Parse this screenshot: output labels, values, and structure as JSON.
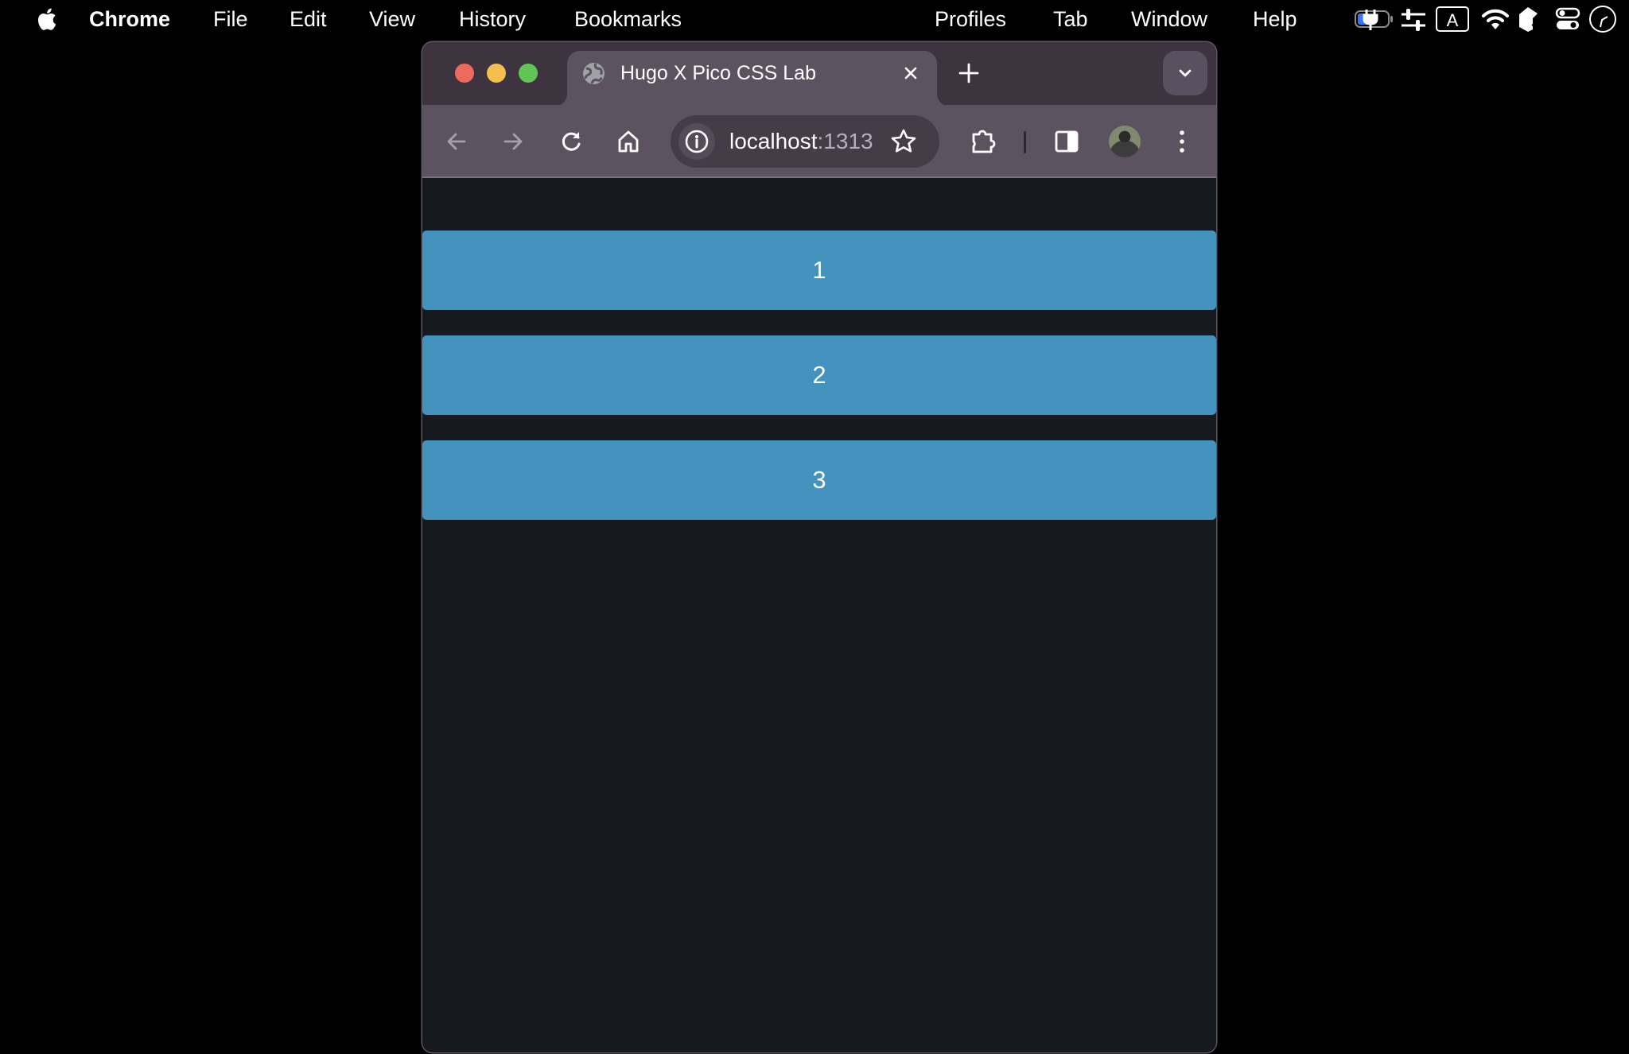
{
  "menubar": {
    "app_name": "Chrome",
    "items": [
      "File",
      "Edit",
      "View",
      "History",
      "Bookmarks",
      "Profiles",
      "Tab",
      "Window",
      "Help"
    ],
    "status_icons": [
      "battery-charging-icon",
      "sliders-icon",
      "input-source-icon",
      "wifi-icon",
      "cube-icon",
      "control-center-icon",
      "clock-icon"
    ],
    "input_source_letter": "A"
  },
  "browser": {
    "tab": {
      "title": "Hugo X Pico CSS Lab",
      "favicon": "globe-icon"
    },
    "address": {
      "host": "localhost",
      "port": ":1313"
    },
    "colors": {
      "titlebar": "#3e343f",
      "tab_active": "#5d5360",
      "omnibox": "#453c47"
    }
  },
  "page": {
    "background": "#161a1f",
    "block_color": "#4493be",
    "blocks": [
      {
        "label": "1"
      },
      {
        "label": "2"
      },
      {
        "label": "3"
      }
    ]
  }
}
